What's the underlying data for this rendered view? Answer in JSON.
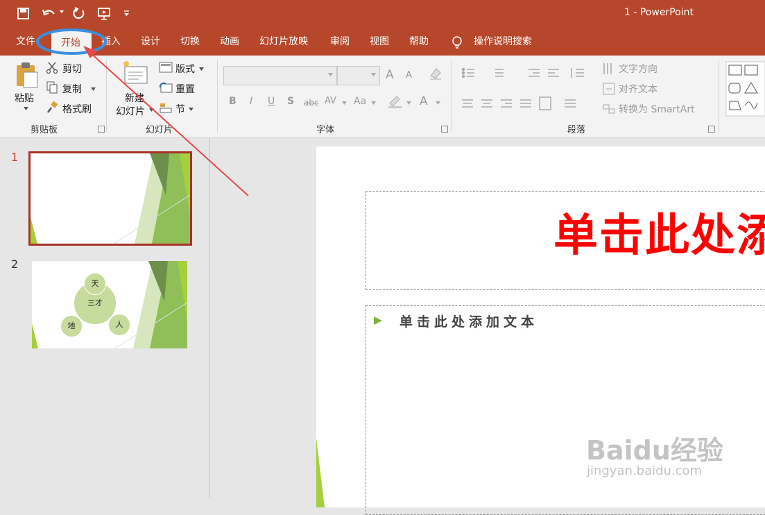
{
  "title_bar": {
    "doc_title": "1  -  PowerPoint"
  },
  "tabs": [
    {
      "label": "文件"
    },
    {
      "label": "开始"
    },
    {
      "label": "插入"
    },
    {
      "label": "设计"
    },
    {
      "label": "切换"
    },
    {
      "label": "动画"
    },
    {
      "label": "幻灯片放映"
    },
    {
      "label": "审阅"
    },
    {
      "label": "视图"
    },
    {
      "label": "帮助"
    }
  ],
  "search_label": "操作说明搜索",
  "ribbon": {
    "clipboard": {
      "paste": "粘贴",
      "cut": "剪切",
      "copy": "复制",
      "format_painter": "格式刷",
      "label": "剪贴板"
    },
    "slides": {
      "new_line1": "新建",
      "new_line2": "幻灯片",
      "layout": "版式",
      "reset": "重置",
      "section": "节",
      "label": "幻灯片"
    },
    "font": {
      "bold": "B",
      "italic": "I",
      "underline": "U",
      "shadow": "S",
      "strike": "abc",
      "spacing": "AV",
      "case": "Aa",
      "color": "A",
      "grow": "A",
      "shrink": "A",
      "label": "字体"
    },
    "paragraph": {
      "text_direction": "文字方向",
      "align_text": "对齐文本",
      "smartart": "转换为 SmartArt",
      "label": "段落"
    }
  },
  "thumbnails": {
    "slide1_num": "1",
    "slide2_num": "2",
    "slide2_circles": {
      "top": "天",
      "center": "三才",
      "left": "地",
      "right": "人"
    }
  },
  "slide": {
    "title_placeholder": "单击此处添加",
    "body_placeholder": "单击此处添加文本"
  },
  "watermark": {
    "line1": "Baidu经验",
    "line2": "jingyan.baidu.com"
  },
  "colors": {
    "accent": "#b7472a",
    "annotation_circle": "#3b8fe0",
    "arrow": "#e8474a",
    "slide_title": "#ff0000",
    "green": "#7cb342"
  }
}
